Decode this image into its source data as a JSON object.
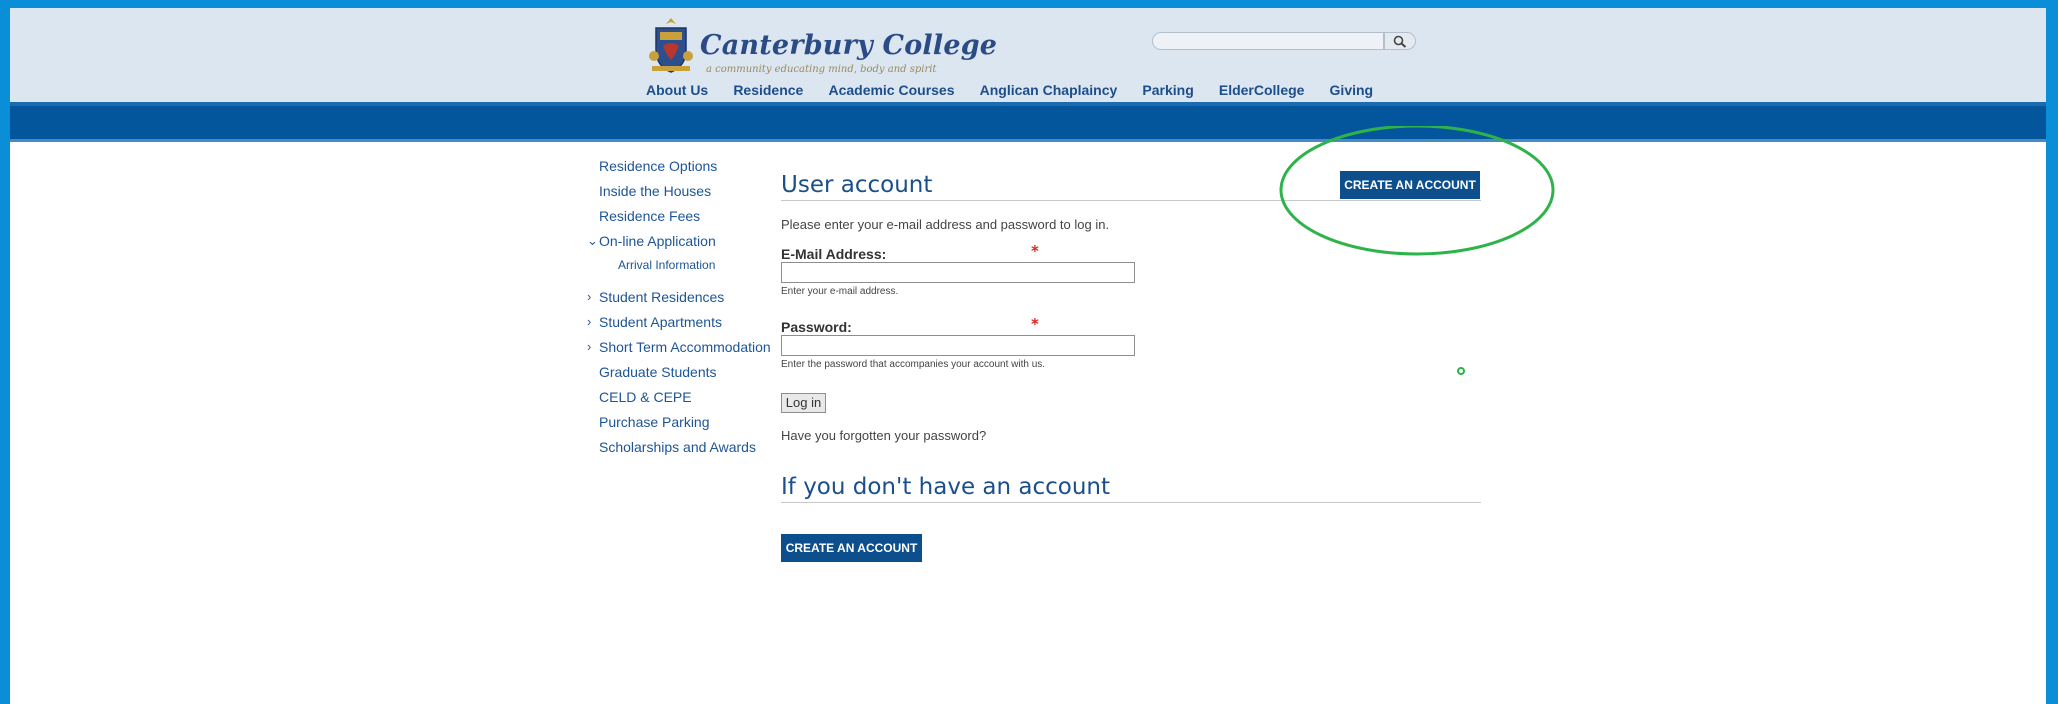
{
  "header": {
    "logo": {
      "title": "Canterbury College",
      "tagline": "a community educating mind, body and spirit"
    },
    "search": {
      "placeholder": ""
    },
    "nav": [
      "About Us",
      "Residence",
      "Academic Courses",
      "Anglican Chaplaincy",
      "Parking",
      "ElderCollege",
      "Giving"
    ]
  },
  "sidebar": {
    "items": [
      {
        "label": "Residence Options"
      },
      {
        "label": "Inside the Houses"
      },
      {
        "label": "Residence Fees"
      },
      {
        "label": "On-line Application",
        "chevron": "chevron-down-icon"
      },
      {
        "label": "Arrival Information"
      },
      {
        "label": "Student Residences",
        "chevron": "chevron-right-icon"
      },
      {
        "label": "Student Apartments",
        "chevron": "chevron-right-icon"
      },
      {
        "label": "Short Term Accommodation",
        "chevron": "chevron-right-icon"
      },
      {
        "label": "Graduate Students"
      },
      {
        "label": "CELD & CEPE"
      },
      {
        "label": "Purchase Parking"
      },
      {
        "label": "Scholarships and Awards"
      }
    ]
  },
  "main": {
    "title": "User account",
    "create_account_top": "CREATE AN ACCOUNT",
    "intro": "Please enter your e-mail address and password to log in.",
    "email": {
      "label": "E-Mail Address:",
      "required_mark": "*",
      "value": "",
      "help": "Enter your e-mail address."
    },
    "password": {
      "label": "Password:",
      "required_mark": "*",
      "value": "",
      "help": "Enter the password that accompanies your account with us."
    },
    "login_button": "Log in",
    "forgot": "Have you forgotten your password?",
    "no_account_title": "If you don't have an account",
    "create_account_bottom": "CREATE AN ACCOUNT"
  },
  "colors": {
    "frame_border": "#0a8ed8",
    "header_bg": "#dbe6f0",
    "blue_bar": "#03569c",
    "link": "#1d5596",
    "button": "#0d4f8d",
    "annotation": "#2db34a",
    "required": "#e0231c"
  }
}
